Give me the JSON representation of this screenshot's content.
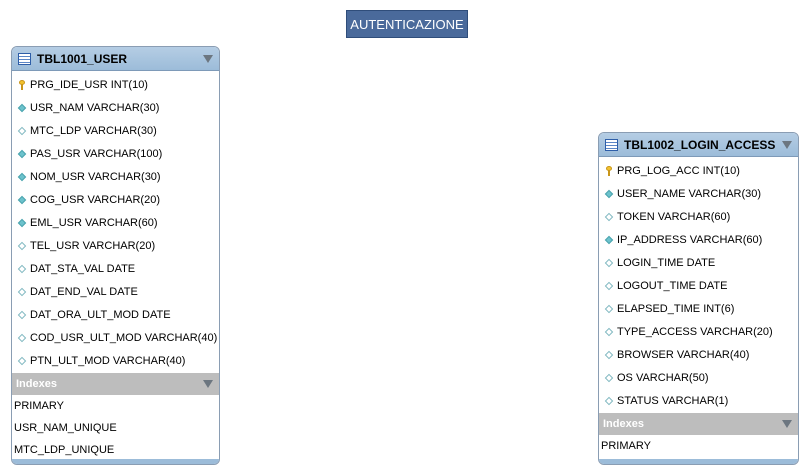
{
  "group": {
    "label": "AUTENTICAZIONE"
  },
  "tables": [
    {
      "name": "TBL1001_USER",
      "columns": [
        {
          "text": "PRG_IDE_USR INT(10)",
          "icon": "primary-key-icon"
        },
        {
          "text": "USR_NAM VARCHAR(30)",
          "icon": "filled-diamond-icon"
        },
        {
          "text": "MTC_LDP VARCHAR(30)",
          "icon": "hollow-diamond-icon"
        },
        {
          "text": "PAS_USR VARCHAR(100)",
          "icon": "filled-diamond-icon"
        },
        {
          "text": "NOM_USR VARCHAR(30)",
          "icon": "filled-diamond-icon"
        },
        {
          "text": "COG_USR VARCHAR(20)",
          "icon": "filled-diamond-icon"
        },
        {
          "text": "EML_USR VARCHAR(60)",
          "icon": "filled-diamond-icon"
        },
        {
          "text": "TEL_USR VARCHAR(20)",
          "icon": "hollow-diamond-icon"
        },
        {
          "text": "DAT_STA_VAL DATE",
          "icon": "hollow-diamond-icon"
        },
        {
          "text": "DAT_END_VAL DATE",
          "icon": "hollow-diamond-icon"
        },
        {
          "text": "DAT_ORA_ULT_MOD DATE",
          "icon": "hollow-diamond-icon"
        },
        {
          "text": "COD_USR_ULT_MOD VARCHAR(40)",
          "icon": "hollow-diamond-icon"
        },
        {
          "text": "PTN_ULT_MOD VARCHAR(40)",
          "icon": "hollow-diamond-icon"
        }
      ],
      "indexes_label": "Indexes",
      "indexes": [
        "PRIMARY",
        "USR_NAM_UNIQUE",
        "MTC_LDP_UNIQUE"
      ]
    },
    {
      "name": "TBL1002_LOGIN_ACCESS",
      "columns": [
        {
          "text": "PRG_LOG_ACC INT(10)",
          "icon": "primary-key-icon"
        },
        {
          "text": "USER_NAME VARCHAR(30)",
          "icon": "filled-diamond-icon"
        },
        {
          "text": "TOKEN VARCHAR(60)",
          "icon": "hollow-diamond-icon"
        },
        {
          "text": "IP_ADDRESS VARCHAR(60)",
          "icon": "filled-diamond-icon"
        },
        {
          "text": "LOGIN_TIME DATE",
          "icon": "hollow-diamond-icon"
        },
        {
          "text": "LOGOUT_TIME DATE",
          "icon": "hollow-diamond-icon"
        },
        {
          "text": "ELAPSED_TIME INT(6)",
          "icon": "hollow-diamond-icon"
        },
        {
          "text": "TYPE_ACCESS VARCHAR(20)",
          "icon": "hollow-diamond-icon"
        },
        {
          "text": "BROWSER VARCHAR(40)",
          "icon": "hollow-diamond-icon"
        },
        {
          "text": "OS VARCHAR(50)",
          "icon": "hollow-diamond-icon"
        },
        {
          "text": "STATUS VARCHAR(1)",
          "icon": "hollow-diamond-icon"
        }
      ],
      "indexes_label": "Indexes",
      "indexes": [
        "PRIMARY"
      ]
    }
  ]
}
